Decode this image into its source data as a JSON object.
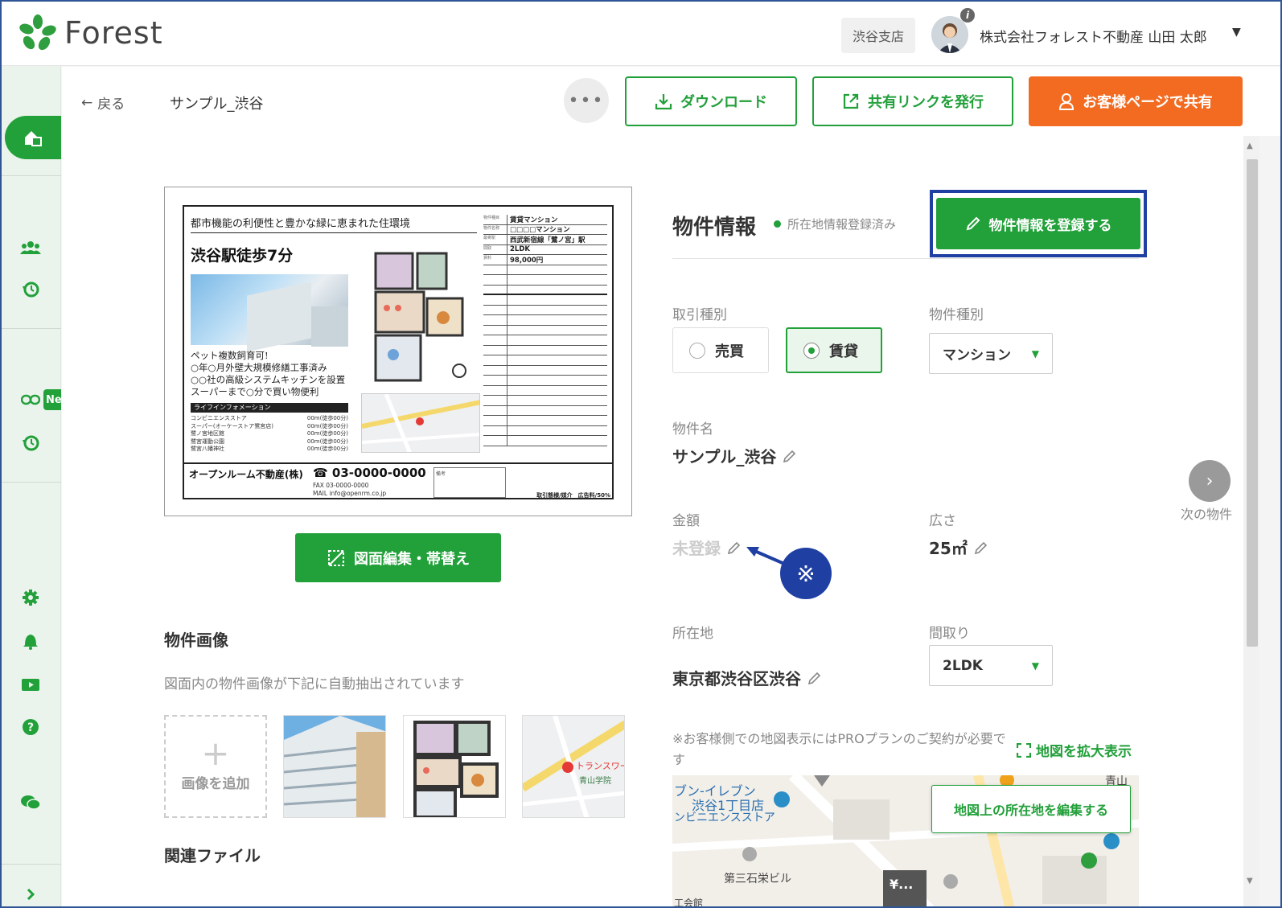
{
  "header": {
    "logo_text": "Forest",
    "branch": "渋谷支店",
    "user_name": "株式会社フォレスト不動産 山田 太郎",
    "info_badge": "i"
  },
  "sidebar": {
    "new_badge": "Ne"
  },
  "toolbar": {
    "back_label": "戻る",
    "page_name": "サンプル_渋谷",
    "more_label": "•••",
    "download_label": "ダウンロード",
    "share_link_label": "共有リンクを発行",
    "customer_share_label": "お客様ページで共有"
  },
  "flyer": {
    "headline": "都市機能の利便性と豊かな緑に恵まれた住環境",
    "title": "渋谷駅徒歩7分",
    "points": [
      "ペット複数飼育可!",
      "○年○月外壁大規模修繕工事済み",
      "○○社の高級システムキッチンを設置",
      "スーパーまで○分で買い物便利"
    ],
    "life_header": "ライフインフォメーション",
    "life": [
      [
        "コンビニエンスストア",
        "00m(徒歩00分)"
      ],
      [
        "スーパー(オーケーストア鷺宮店)",
        "00m(徒歩00分)"
      ],
      [
        "鷺ノ宮地区館",
        "00m(徒歩00分)"
      ],
      [
        "鷺宮運動公園",
        "00m(徒歩00分)"
      ],
      [
        "鷺宮八幡神社",
        "00m(徒歩00分)"
      ]
    ],
    "table": [
      [
        "物件種目",
        "賃貸マンション"
      ],
      [
        "物件名称",
        "□□□□マンション"
      ],
      [
        "最寄駅",
        "西武新宿線「鷺ノ宮」駅"
      ],
      [
        "間取",
        "2LDK"
      ],
      [
        "賃料",
        "98,000円"
      ]
    ],
    "company": "オープンルーム不動産(株)",
    "phone": "03-0000-0000",
    "fax": "03-0000-0000",
    "mail": "info@openrm.co.jp",
    "biko": "備考",
    "ad": "取引態様/媒介　広告料/50%"
  },
  "edit_drawing_label": "図面編集・帯替え",
  "images_section": {
    "title": "物件画像",
    "desc": "図面内の物件画像が下記に自動抽出されています",
    "add_label": "画像を追加"
  },
  "files_section": {
    "title": "関連ファイル"
  },
  "property": {
    "title": "物件情報",
    "status": "所在地情報登録済み",
    "register_label": "物件情報を登録する",
    "deal_type_label": "取引種別",
    "deal_options": [
      "売買",
      "賃貸"
    ],
    "deal_selected": "賃貸",
    "kind_label": "物件種別",
    "kind_value": "マンション",
    "name_label": "物件名",
    "name_value": "サンプル_渋谷",
    "price_label": "金額",
    "price_value": "未登録",
    "area_label": "広さ",
    "area_value": "25㎡",
    "address_label": "所在地",
    "address_value": "東京都渋谷区渋谷",
    "layout_label": "間取り",
    "layout_value": "2LDK",
    "next_label": "次の物件",
    "note_mark": "※"
  },
  "map": {
    "note": "※お客様側での地図表示にはPROプランのご契約が必要です",
    "expand_label": "地図を拡大表示",
    "edit_label": "地図上の所在地を編集する",
    "labels": [
      "ブン-イレブン",
      "渋谷1丁目店",
      "ンビニエンスストア",
      "第三石栄ビル",
      "工会館",
      "青山",
      "¥..."
    ]
  },
  "colors": {
    "brand_green": "#22a03a",
    "orange": "#f26b21",
    "highlight_blue": "#1f3fa3"
  }
}
